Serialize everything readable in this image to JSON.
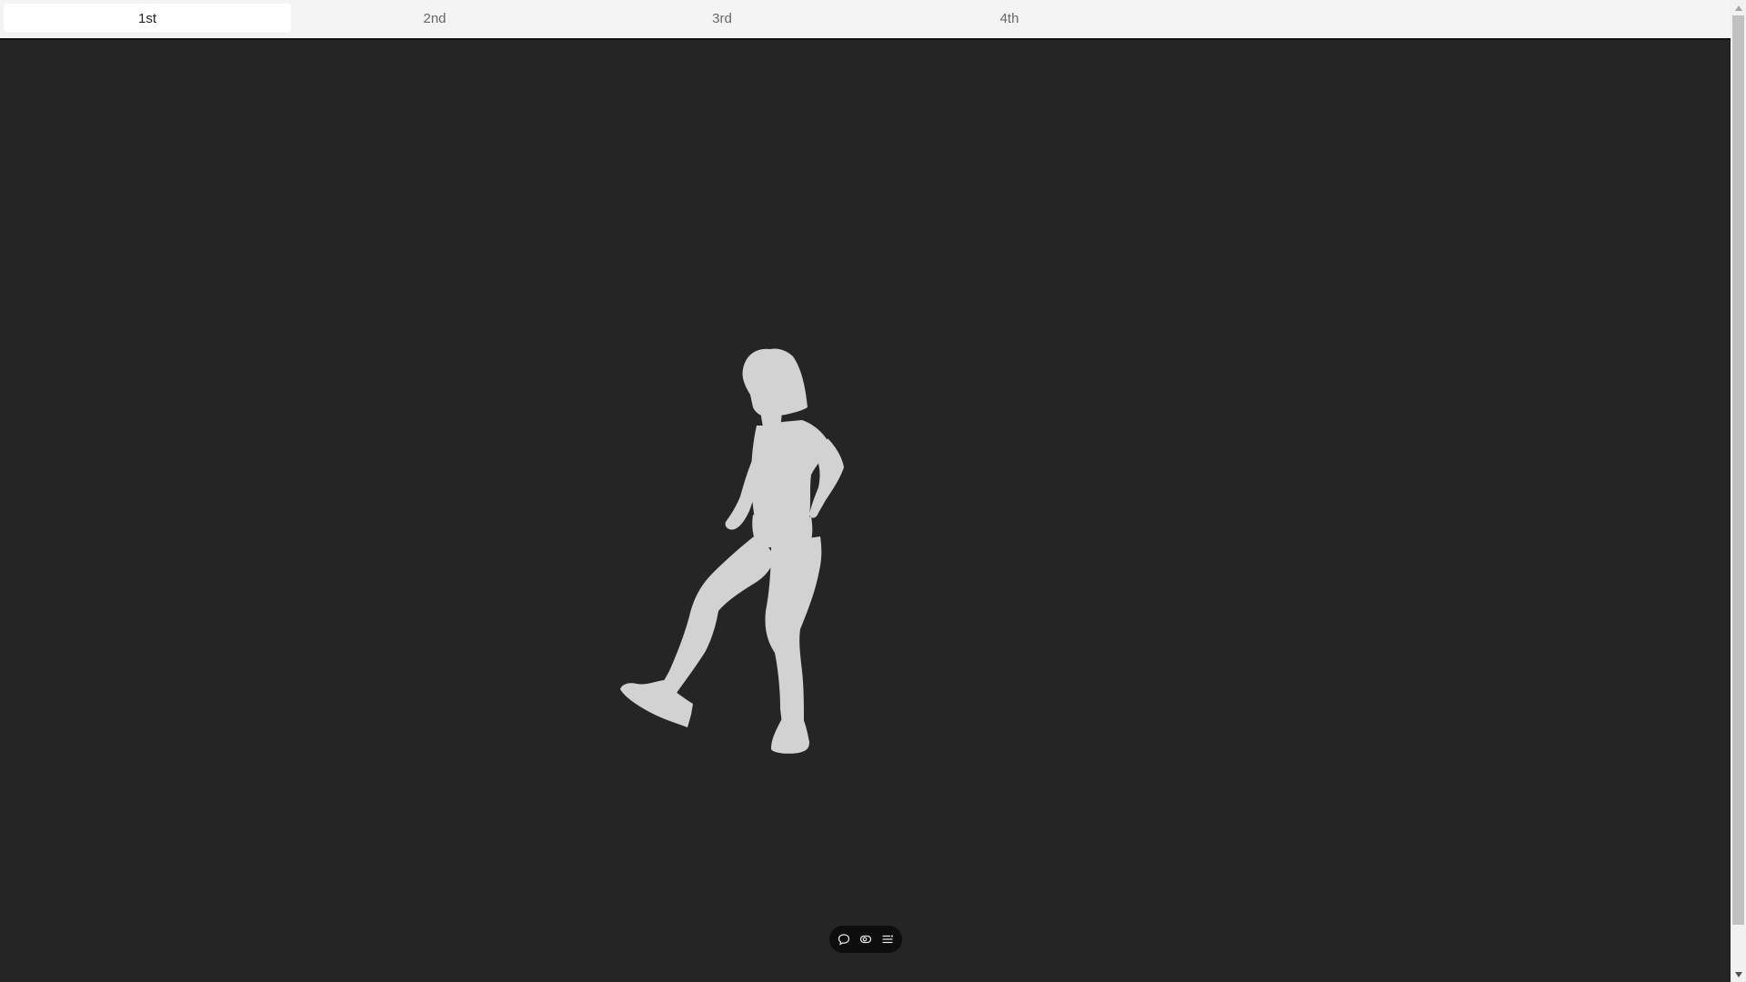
{
  "tabs": [
    {
      "label": "1st",
      "active": true
    },
    {
      "label": "2nd",
      "active": false
    },
    {
      "label": "3rd",
      "active": false
    },
    {
      "label": "4th",
      "active": false
    }
  ],
  "viewport": {
    "background": "#252525",
    "figure_color": "#d2d2d2",
    "figure_description": ""
  },
  "toolbar": {
    "buttons": [
      {
        "icon": "chat-bubble-icon"
      },
      {
        "icon": "eye-toggle-icon"
      },
      {
        "icon": "list-settings-icon"
      }
    ]
  },
  "colors": {
    "tabbar_bg": "#f4f4f4",
    "active_tab_bg": "#ffffff",
    "toolbar_bg": "#0d0d0d",
    "scrollbar_thumb": "#c1c1c1"
  }
}
